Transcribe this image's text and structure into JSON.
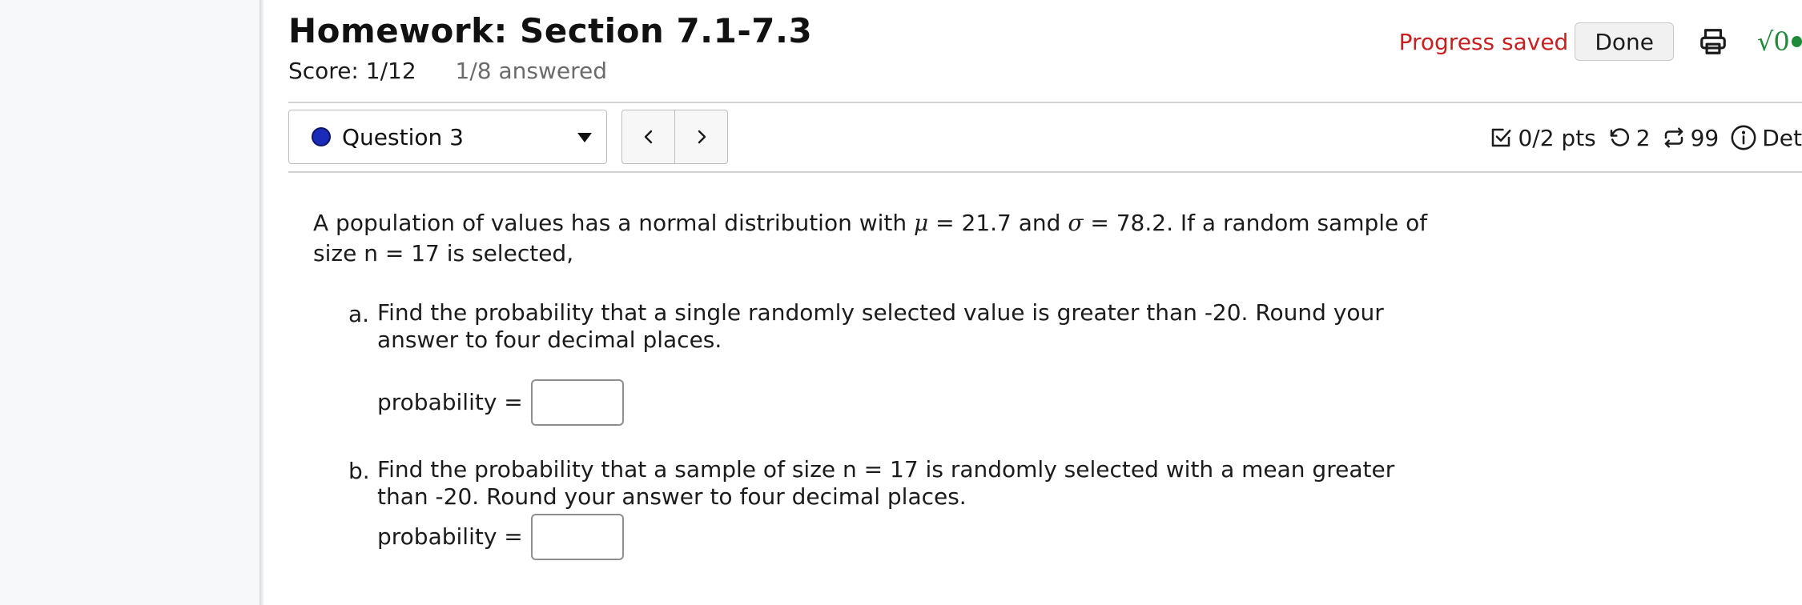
{
  "header": {
    "title": "Homework: Section 7.1-7.3",
    "score": "Score: 1/12",
    "answered": "1/8 answered",
    "progress_status": "Progress saved",
    "done_label": "Done",
    "math_indicator": "√0"
  },
  "question_nav": {
    "current": "Question 3",
    "prev_label": "<",
    "next_label": ">"
  },
  "meta": {
    "points": "0/2 pts",
    "retries": "2",
    "attempts": "99",
    "details": "Det"
  },
  "problem": {
    "intro_1": "A population of values has a normal distribution with ",
    "mu": "μ",
    "intro_2": " = 21.7 and ",
    "sigma": "σ",
    "intro_3": " = 78.2. If a random sample of size n = 17 is selected,",
    "parts": [
      {
        "letter": "a.",
        "text": "Find the probability that a single randomly selected value is greater than -20. Round your answer to four decimal places.",
        "answer_label": "probability =",
        "answer_value": ""
      },
      {
        "letter": "b.",
        "text": "Find the probability that a sample of size n = 17 is randomly selected with a mean greater than -20. Round your answer to four decimal places.",
        "answer_label": "probability =",
        "answer_value": ""
      }
    ]
  },
  "colors": {
    "progress_saved": "#c8201f",
    "status_dot": "#1a2bb8",
    "math_indicator": "#1f8a3a"
  },
  "icons": [
    "print-icon",
    "checkbox-icon",
    "retry-icon",
    "attempts-icon",
    "info-icon",
    "caret-down-icon",
    "chevron-left-icon",
    "chevron-right-icon"
  ]
}
